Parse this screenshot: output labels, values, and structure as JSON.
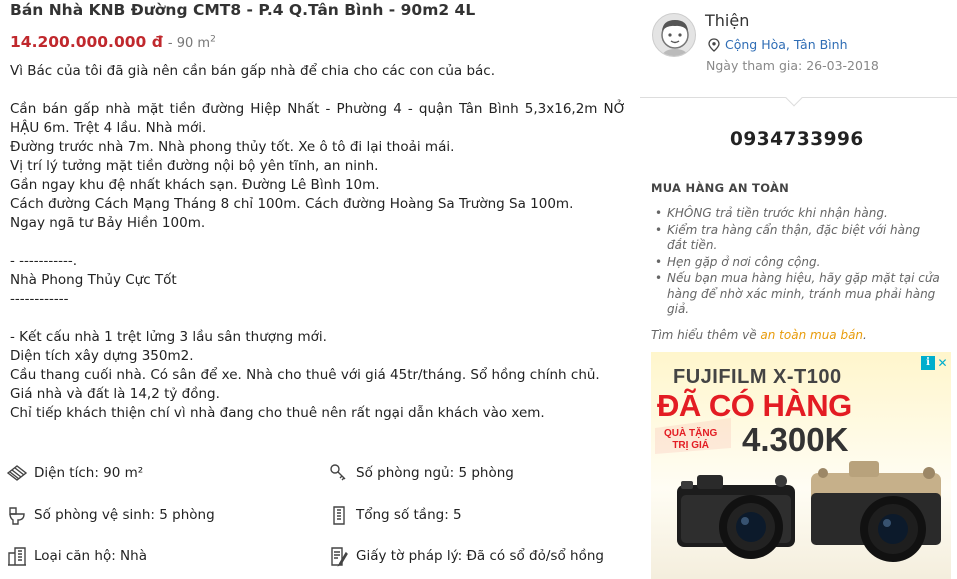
{
  "listing": {
    "title": "Bán Nhà KNB Đường CMT8 - P.4 Q.Tân Bình - 90m2 4L",
    "price": "14.200.000.000 đ",
    "area_prefix": "- 90 m",
    "area_sup": "2",
    "description": [
      "Vì Bác của tôi đã già nên cần bán gấp nhà để chia cho các con của bác.",
      "",
      "Cần bán gấp nhà mặt tiền đường Hiệp Nhất - Phường 4 - quận Tân Bình 5,3x16,2m NỞ HẬU 6m. Trệt 4 lầu. Nhà mới.",
      "Đường trước nhà 7m. Nhà phong thủy tốt. Xe ô tô đi lại thoải mái.",
      "Vị trí lý tưởng mặt tiền đường nội bộ yên tĩnh, an ninh.",
      "Gần ngay khu đệ nhất khách sạn. Đường Lê Bình 10m.",
      "Cách đường Cách Mạng Tháng 8 chỉ 100m. Cách đường Hoàng Sa Trường Sa 100m.",
      "Ngay ngã tư Bảy Hiền 100m.",
      "",
      "- -----------.",
      "Nhà Phong Thủy Cực Tốt",
      "------------",
      "",
      "- Kết cấu nhà 1 trệt lửng 3 lầu sân thượng mới.",
      "Diện tích xây dựng 350m2.",
      "Cầu thang cuối nhà. Có sân để xe. Nhà cho thuê với giá 45tr/tháng. Sổ hồng chính chủ.",
      "Giá nhà và đất là 14,2 tỷ đồng.",
      "Chỉ tiếp khách thiện chí vì nhà đang cho thuê nên rất ngại dẫn khách vào xem."
    ],
    "params": {
      "area": "Diện tích: 90 m²",
      "bedrooms": "Số phòng ngủ: 5 phòng",
      "bathrooms": "Số phòng vệ sinh: 5 phòng",
      "floors": "Tổng số tầng: 5",
      "type": "Loại căn hộ: Nhà",
      "legal": "Giấy tờ pháp lý: Đã có sổ đỏ/sổ hồng"
    }
  },
  "seller": {
    "name": "Thiện",
    "location": "Cộng Hòa, Tân Bình",
    "joined": "Ngày tham gia: 26-03-2018",
    "phone": "0934733996"
  },
  "safety": {
    "title": "MUA HÀNG AN TOÀN",
    "tips": [
      "KHÔNG trả tiền trước khi nhận hàng.",
      "Kiểm tra hàng cẩn thận, đặc biệt với hàng đắt tiền.",
      "Hẹn gặp ở nơi công cộng.",
      "Nếu bạn mua hàng hiệu, hãy gặp mặt tại cửa hàng để nhờ xác minh, tránh mua phải hàng giả."
    ],
    "learn_more_prefix": "Tìm hiểu thêm về ",
    "learn_more_link": "an toàn mua bán",
    "learn_more_suffix": "."
  },
  "ad": {
    "brand": "FUJIFILM X-T100",
    "headline": "ĐÃ CÓ HÀNG",
    "gift_line1": "QUÀ TẶNG",
    "gift_line2": "TRỊ GIÁ",
    "value": "4.300K",
    "info_icon": "info-icon",
    "close_icon": "close-icon",
    "accent": "#e31c23"
  },
  "colors": {
    "price": "#c0282d",
    "link": "#2f6db5",
    "learn_more_link": "#e89c0c",
    "ad_accent": "#00aecd"
  }
}
